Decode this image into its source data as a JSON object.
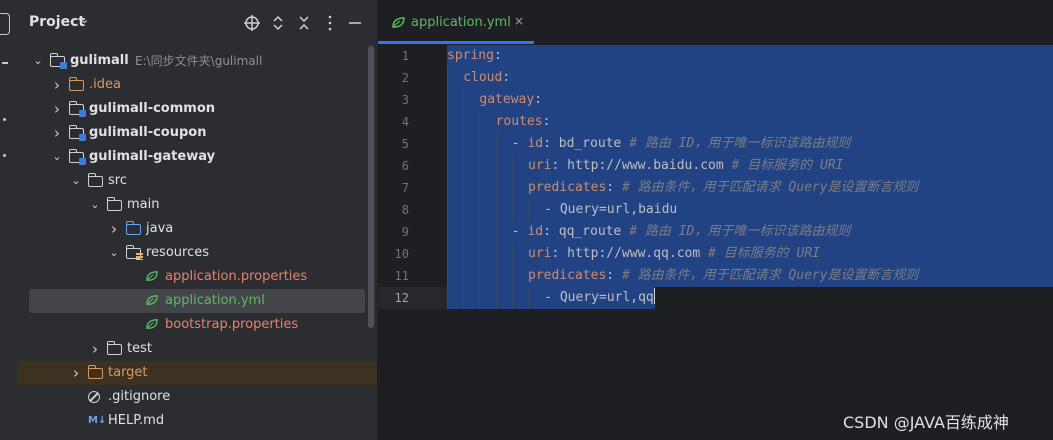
{
  "panel": {
    "title": "Project",
    "title_caret": "⌄",
    "header_icons": [
      "locate-icon",
      "expand-all-icon",
      "collapse-all-icon",
      "hide-icon"
    ]
  },
  "tree": [
    {
      "label": "gulimall",
      "hint": "E:\\同步文件夹\\gulimall",
      "depth": 0,
      "expanded": true,
      "icon": "module-folder",
      "bold": true,
      "color": "#dfe1e5"
    },
    {
      "label": ".idea",
      "depth": 1,
      "expanded": false,
      "icon": "folder",
      "color": "#d99a5e"
    },
    {
      "label": "gulimall-common",
      "depth": 1,
      "expanded": false,
      "icon": "module-folder",
      "bold": true,
      "color": "#dfe1e5"
    },
    {
      "label": "gulimall-coupon",
      "depth": 1,
      "expanded": false,
      "icon": "module-folder",
      "bold": true,
      "color": "#dfe1e5"
    },
    {
      "label": "gulimall-gateway",
      "depth": 1,
      "expanded": true,
      "icon": "module-folder",
      "bold": true,
      "color": "#dfe1e5"
    },
    {
      "label": "src",
      "depth": 2,
      "expanded": true,
      "icon": "folder",
      "color": "#dfe1e5"
    },
    {
      "label": "main",
      "depth": 3,
      "expanded": true,
      "icon": "folder",
      "color": "#dfe1e5"
    },
    {
      "label": "java",
      "depth": 4,
      "expanded": false,
      "icon": "source-folder",
      "color": "#dfe1e5"
    },
    {
      "label": "resources",
      "depth": 4,
      "expanded": true,
      "icon": "resources-folder",
      "color": "#dfe1e5"
    },
    {
      "label": "application.properties",
      "depth": 5,
      "icon": "spring-leaf",
      "color": "#e6836c"
    },
    {
      "label": "application.yml",
      "depth": 5,
      "icon": "spring-leaf",
      "color": "#5fb865",
      "selected": true
    },
    {
      "label": "bootstrap.properties",
      "depth": 5,
      "icon": "spring-leaf",
      "color": "#e6836c"
    },
    {
      "label": "test",
      "depth": 3,
      "expanded": false,
      "icon": "folder",
      "color": "#dfe1e5"
    },
    {
      "label": "target",
      "depth": 2,
      "expanded": false,
      "icon": "excluded-folder",
      "color": "#d99a5e",
      "excluded": true
    },
    {
      "label": ".gitignore",
      "depth": 2,
      "icon": "ignore",
      "color": "#dfe1e5"
    },
    {
      "label": "HELP.md",
      "depth": 2,
      "icon": "markdown",
      "color": "#dfe1e5"
    }
  ],
  "editor": {
    "tab_label": "application.yml",
    "tab_close": "×",
    "current_line": 12,
    "lines": [
      {
        "n": "1",
        "indent": 0,
        "parts": [
          [
            "k",
            "spring"
          ],
          [
            "p",
            ":"
          ]
        ]
      },
      {
        "n": "2",
        "indent": 1,
        "parts": [
          [
            "k",
            "cloud"
          ],
          [
            "p",
            ":"
          ]
        ]
      },
      {
        "n": "3",
        "indent": 2,
        "parts": [
          [
            "k",
            "gateway"
          ],
          [
            "p",
            ":"
          ]
        ]
      },
      {
        "n": "4",
        "indent": 3,
        "parts": [
          [
            "k",
            "routes"
          ],
          [
            "p",
            ":"
          ]
        ]
      },
      {
        "n": "5",
        "indent": 4,
        "parts": [
          [
            "p",
            "- "
          ],
          [
            "k",
            "id"
          ],
          [
            "p",
            ": bd_route "
          ],
          [
            "c",
            "# 路由 ID，用于唯一标识该路由规则"
          ]
        ]
      },
      {
        "n": "6",
        "indent": 5,
        "parts": [
          [
            "k",
            "uri"
          ],
          [
            "p",
            ": http://www.baidu.com "
          ],
          [
            "c",
            "# 目标服务的 URI"
          ]
        ]
      },
      {
        "n": "7",
        "indent": 5,
        "parts": [
          [
            "k",
            "predicates"
          ],
          [
            "p",
            ": "
          ],
          [
            "c",
            "# 路由条件，用于匹配请求 Query是设置断言规则"
          ]
        ]
      },
      {
        "n": "8",
        "indent": 6,
        "parts": [
          [
            "p",
            "- Query=url,baidu"
          ]
        ]
      },
      {
        "n": "9",
        "indent": 4,
        "parts": [
          [
            "p",
            "- "
          ],
          [
            "k",
            "id"
          ],
          [
            "p",
            ": qq_route "
          ],
          [
            "c",
            "# 路由 ID，用于唯一标识该路由规则"
          ]
        ]
      },
      {
        "n": "10",
        "indent": 5,
        "parts": [
          [
            "k",
            "uri"
          ],
          [
            "p",
            ": http://www.qq.com "
          ],
          [
            "c",
            "# 目标服务的 URI"
          ]
        ]
      },
      {
        "n": "11",
        "indent": 5,
        "parts": [
          [
            "k",
            "predicates"
          ],
          [
            "p",
            ": "
          ],
          [
            "c",
            "# 路由条件，用于匹配请求 Query是设置断言规则"
          ]
        ]
      },
      {
        "n": "12",
        "indent": 6,
        "parts": [
          [
            "p",
            "- Query=url,qq"
          ]
        ],
        "caret": true
      }
    ]
  },
  "watermark": "CSDN @JAVA百练成神",
  "colors": {
    "accent": "#3574f0",
    "selection": "#214283",
    "yaml_key": "#ce8d6d",
    "comment": "#7a7e85"
  }
}
